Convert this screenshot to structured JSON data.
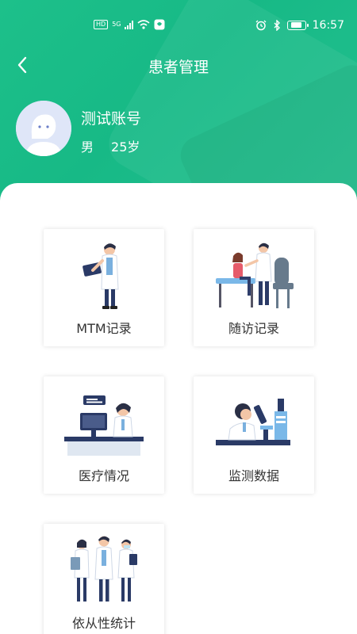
{
  "status_bar": {
    "left_badge": "HD",
    "network": "5G",
    "time": "16:57"
  },
  "header": {
    "title": "患者管理",
    "back_icon": "chevron-left-icon"
  },
  "patient": {
    "name": "测试账号",
    "gender": "男",
    "age": "25岁"
  },
  "menu": [
    {
      "label": "MTM记录",
      "icon": "doctor-tablet-illustration"
    },
    {
      "label": "随访记录",
      "icon": "doctor-child-illustration"
    },
    {
      "label": "医疗情况",
      "icon": "doctor-computer-illustration"
    },
    {
      "label": "监测数据",
      "icon": "microscope-illustration"
    },
    {
      "label": "依从性统计",
      "icon": "medical-team-illustration"
    }
  ],
  "colors": {
    "brand": "#1dc08a",
    "card_shadow": "#dddddd"
  }
}
